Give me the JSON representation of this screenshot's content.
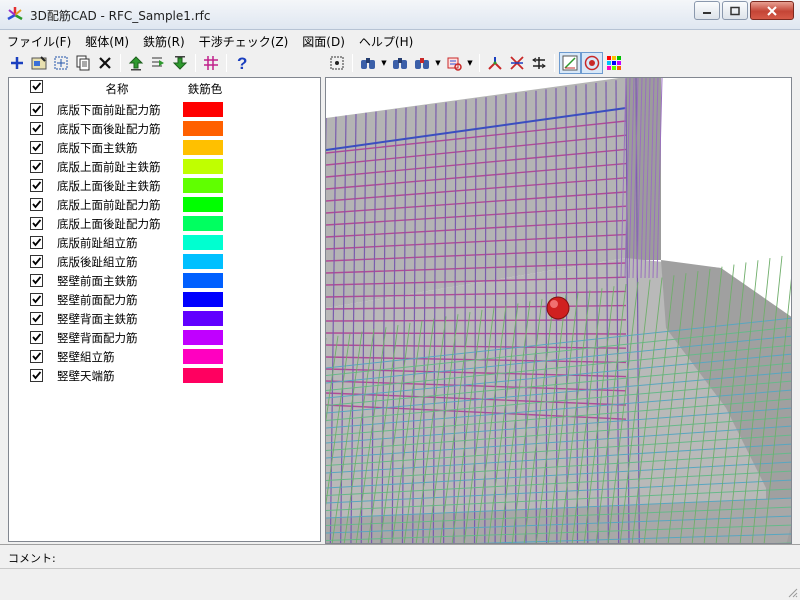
{
  "window": {
    "title": "3D配筋CAD - RFC_Sample1.rfc"
  },
  "menu": [
    {
      "label": "ファイル(F)"
    },
    {
      "label": "躯体(M)"
    },
    {
      "label": "鉄筋(R)"
    },
    {
      "label": "干渉チェック(Z)"
    },
    {
      "label": "図面(D)"
    },
    {
      "label": "ヘルプ(H)"
    }
  ],
  "list": {
    "header_name": "名称",
    "header_color": "鉄筋色",
    "rows": [
      {
        "name": "底版下面前趾配力筋",
        "color": "#ff0000",
        "checked": true
      },
      {
        "name": "底版下面後趾配力筋",
        "color": "#ff6000",
        "checked": true
      },
      {
        "name": "底版下面主鉄筋",
        "color": "#ffc000",
        "checked": true
      },
      {
        "name": "底版上面前趾主鉄筋",
        "color": "#c0ff00",
        "checked": true
      },
      {
        "name": "底版上面後趾主鉄筋",
        "color": "#60ff00",
        "checked": true
      },
      {
        "name": "底版上面前趾配力筋",
        "color": "#00ff00",
        "checked": true
      },
      {
        "name": "底版上面後趾配力筋",
        "color": "#00ff60",
        "checked": true
      },
      {
        "name": "底版前趾組立筋",
        "color": "#00ffd0",
        "checked": true
      },
      {
        "name": "底版後趾組立筋",
        "color": "#00c0ff",
        "checked": true
      },
      {
        "name": "竪壁前面主鉄筋",
        "color": "#0060ff",
        "checked": true
      },
      {
        "name": "竪壁前面配力筋",
        "color": "#0000ff",
        "checked": true
      },
      {
        "name": "竪壁背面主鉄筋",
        "color": "#6000ff",
        "checked": true
      },
      {
        "name": "竪壁背面配力筋",
        "color": "#c000ff",
        "checked": true
      },
      {
        "name": "竪壁組立筋",
        "color": "#ff00c0",
        "checked": true
      },
      {
        "name": "竪壁天端筋",
        "color": "#ff0060",
        "checked": true
      }
    ]
  },
  "comment": {
    "label": "コメント:"
  }
}
